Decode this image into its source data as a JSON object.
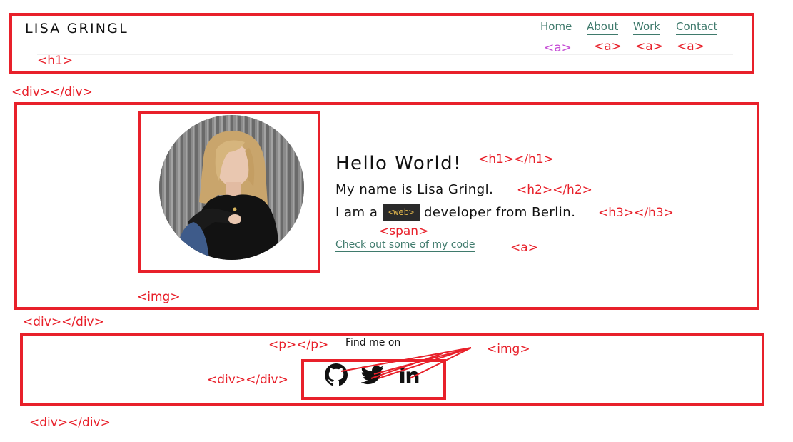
{
  "header": {
    "logo": "LISA GRINGL",
    "nav": [
      "Home",
      "About",
      "Work",
      "Contact"
    ]
  },
  "hero": {
    "heading": "Hello World!",
    "name_line": "My name is Lisa Gringl.",
    "role_prefix": "I am a",
    "role_tag": "<web>",
    "role_suffix": "developer from Berlin.",
    "code_link": "Check out some of my code"
  },
  "footer": {
    "find_me": "Find me on",
    "socials": [
      "github-icon",
      "twitter-icon",
      "linkedin-icon"
    ]
  },
  "annotations": {
    "header_h1": "<h1>",
    "nav_a": [
      "<a>",
      "<a>",
      "<a>",
      "<a>"
    ],
    "div_1": "<div></div>",
    "hero_h1": "<h1></h1>",
    "hero_h2": "<h2></h2>",
    "hero_h3": "<h3></h3>",
    "hero_span": "<span>",
    "hero_a": "<a>",
    "hero_img": "<img>",
    "div_2": "<div></div>",
    "footer_p": "<p></p>",
    "footer_img": "<img>",
    "footer_div_inner": "<div></div>",
    "div_3": "<div></div>"
  },
  "colors": {
    "annotation_red": "#e8202a",
    "annotation_purple": "#c64fd6",
    "link_green": "#3f7a6c",
    "tag_bg": "#2a2a2a",
    "tag_text": "#e0b54c"
  }
}
